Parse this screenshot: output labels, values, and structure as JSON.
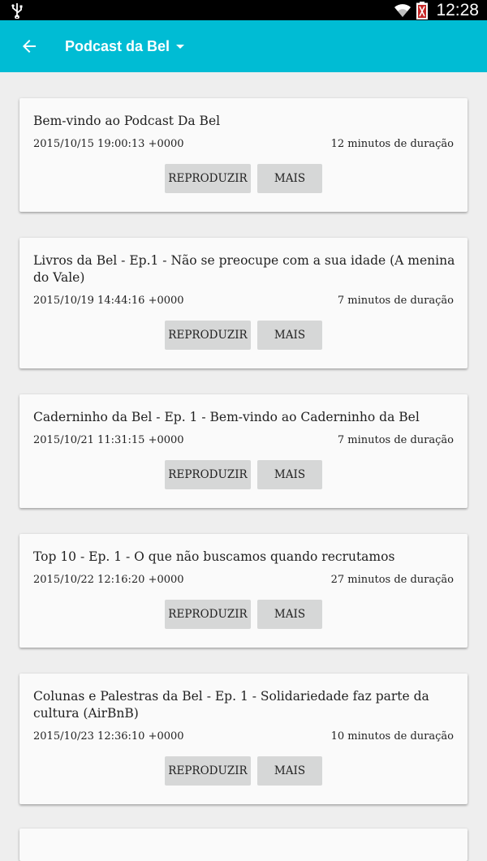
{
  "status_bar": {
    "time": "12:28"
  },
  "app_bar": {
    "title": "Podcast da Bel"
  },
  "episodes": [
    {
      "title": "Bem-vindo ao Podcast Da Bel",
      "date": "2015/10/15 19:00:13 +0000",
      "duration": "12 minutos de duração",
      "play_label": "REPRODUZIR",
      "more_label": "MAIS"
    },
    {
      "title": "Livros da Bel - Ep.1 - Não se preocupe com a sua idade (A menina do Vale)",
      "date": "2015/10/19 14:44:16 +0000",
      "duration": "7 minutos de duração",
      "play_label": "REPRODUZIR",
      "more_label": "MAIS"
    },
    {
      "title": "Caderninho da Bel - Ep. 1 - Bem-vindo ao Caderninho da Bel",
      "date": "2015/10/21 11:31:15 +0000",
      "duration": "7 minutos de duração",
      "play_label": "REPRODUZIR",
      "more_label": "MAIS"
    },
    {
      "title": "Top 10 - Ep. 1 - O que não buscamos quando recrutamos",
      "date": "2015/10/22 12:16:20 +0000",
      "duration": "27 minutos de duração",
      "play_label": "REPRODUZIR",
      "more_label": "MAIS"
    },
    {
      "title": "Colunas e Palestras da Bel - Ep. 1 - Solidariedade faz parte da cultura (AirBnB)",
      "date": "2015/10/23 12:36:10 +0000",
      "duration": "10 minutos de duração",
      "play_label": "REPRODUZIR",
      "more_label": "MAIS"
    }
  ]
}
